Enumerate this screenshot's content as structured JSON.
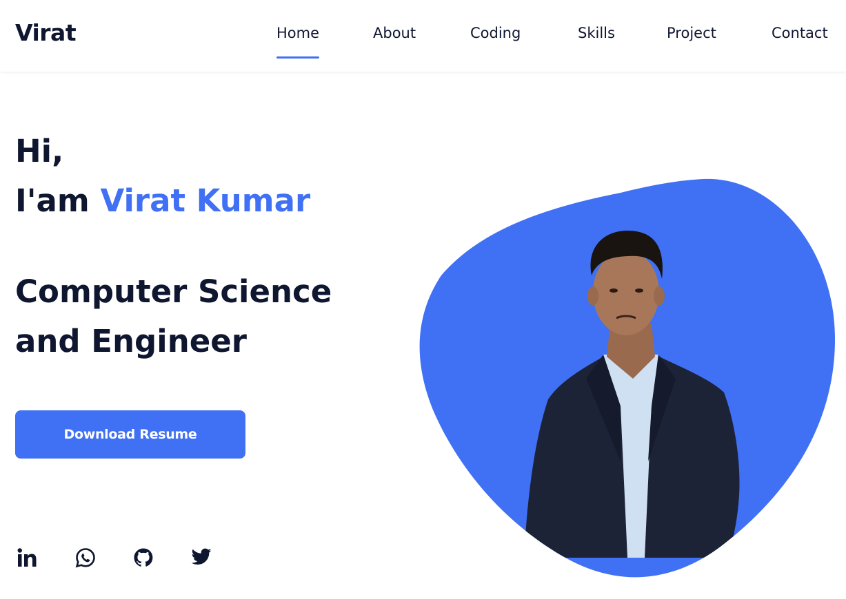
{
  "header": {
    "logo": "Virat",
    "nav": [
      {
        "label": "Home",
        "active": true
      },
      {
        "label": "About",
        "active": false
      },
      {
        "label": "Coding",
        "active": false
      },
      {
        "label": "Skills",
        "active": false
      },
      {
        "label": "Project",
        "active": false
      },
      {
        "label": "Contact",
        "active": false
      }
    ]
  },
  "hero": {
    "greeting": "Hi,",
    "intro_prefix": "I'am",
    "name": "Virat Kumar",
    "role_line1": "Computer Science",
    "role_line2": "and Engineer",
    "button_label": "Download Resume"
  },
  "social": [
    {
      "icon": "linkedin-icon"
    },
    {
      "icon": "whatsapp-icon"
    },
    {
      "icon": "github-icon"
    },
    {
      "icon": "twitter-icon"
    }
  ],
  "colors": {
    "accent": "#4070f4",
    "text": "#0e1630",
    "background": "#ffffff"
  }
}
